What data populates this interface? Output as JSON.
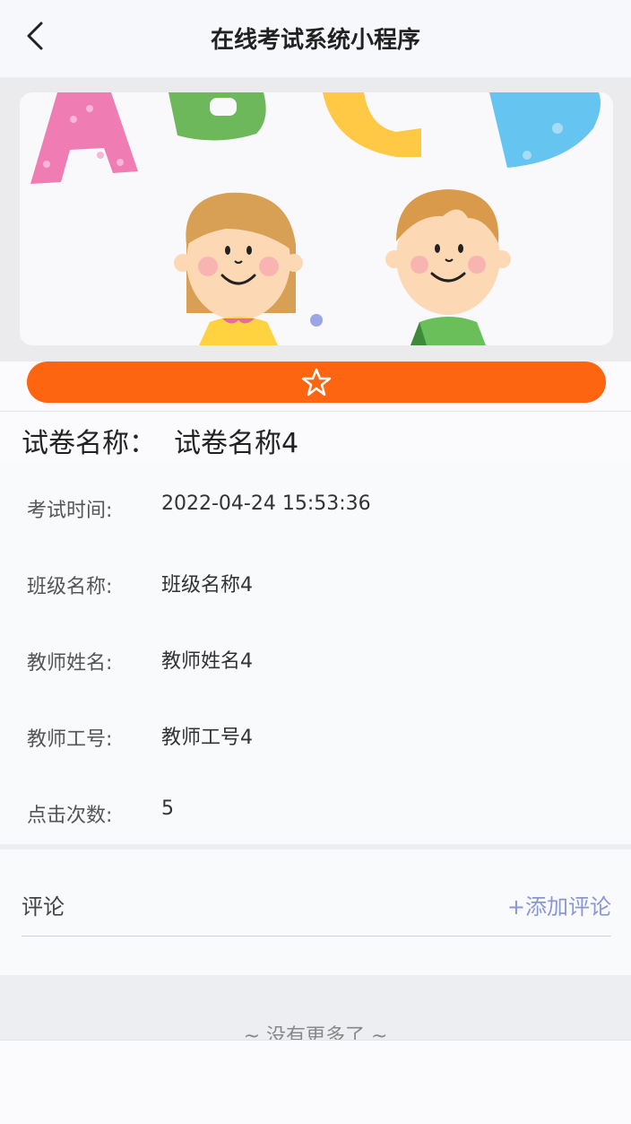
{
  "nav": {
    "title": "在线考试系统小程序"
  },
  "banner": {
    "letters": [
      "A",
      "B",
      "C",
      "D"
    ]
  },
  "favorite": {
    "icon": "star-outline-icon",
    "color": "#fd6510"
  },
  "paper": {
    "label": "试卷名称：",
    "value": "试卷名称4"
  },
  "info": [
    {
      "label": "考试时间:",
      "value": "2022-04-24 15:53:36"
    },
    {
      "label": "班级名称:",
      "value": "班级名称4"
    },
    {
      "label": "教师姓名:",
      "value": "教师姓名4"
    },
    {
      "label": "教师工号:",
      "value": "教师工号4"
    },
    {
      "label": "点击次数:",
      "value": "5"
    }
  ],
  "comment": {
    "label": "评论",
    "add_label": "+添加评论"
  },
  "footer": {
    "no_more": "~ 没有更多了 ~"
  }
}
